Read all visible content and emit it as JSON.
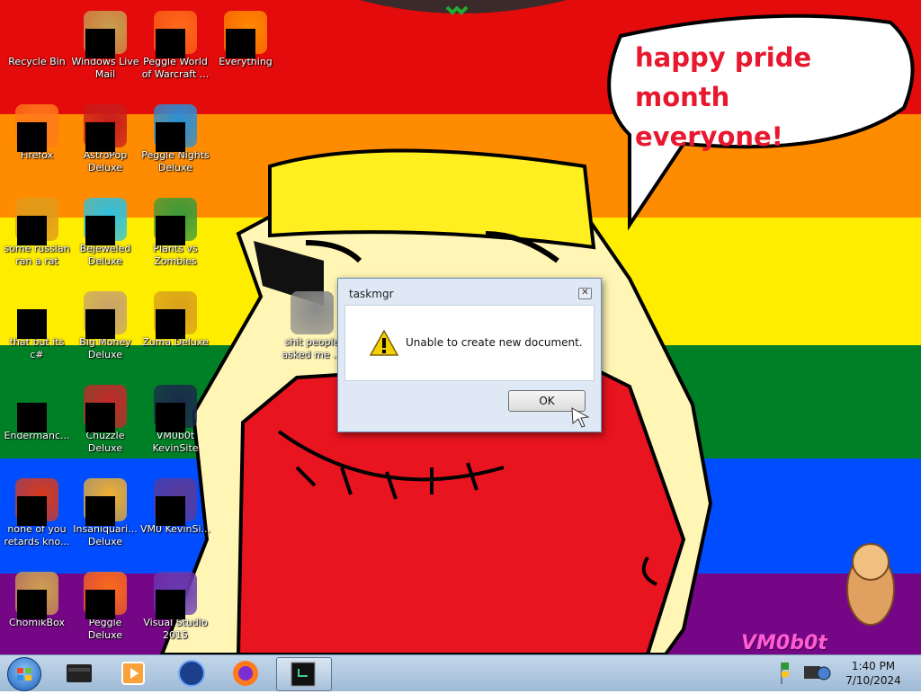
{
  "wallpaper": {
    "stripes": [
      "#e30b0b",
      "#ff8c00",
      "#ffed00",
      "#008026",
      "#004dff",
      "#750787"
    ],
    "speech_bubble": [
      "happy pride month",
      "everyone!"
    ],
    "watermark": "VM0b0t"
  },
  "desktop_icons": [
    {
      "label": "Recycle Bin",
      "icon": "recycle-bin-icon",
      "redacted": false
    },
    {
      "label": "Windows Live Mail",
      "icon": "mail-icon",
      "redacted": true
    },
    {
      "label": "Peggle World of Warcraft ...",
      "icon": "peggle-icon",
      "redacted": true
    },
    {
      "label": "Everything",
      "icon": "search-icon",
      "redacted": true
    },
    {
      "label": "Firefox",
      "icon": "firefox-icon",
      "redacted": true
    },
    {
      "label": "AstroPop Deluxe",
      "icon": "astropop-icon",
      "redacted": true
    },
    {
      "label": "Peggle Nights Deluxe",
      "icon": "peggle-nights-icon",
      "redacted": true
    },
    {
      "label": "some russian ran a rat",
      "icon": "app-icon",
      "redacted": true
    },
    {
      "label": "Bejeweled Deluxe",
      "icon": "gem-icon",
      "redacted": true
    },
    {
      "label": "Plants vs Zombies",
      "icon": "plant-icon",
      "redacted": true
    },
    {
      "label": "that but its c#",
      "icon": "shortcut-icon",
      "redacted": true
    },
    {
      "label": "Big Money Deluxe",
      "icon": "money-bag-icon",
      "redacted": true
    },
    {
      "label": "Zuma Deluxe",
      "icon": "zuma-icon",
      "redacted": true
    },
    {
      "label": "shit people asked me ...",
      "icon": "folder-icon",
      "redacted": false
    },
    {
      "label": "Endermanc...",
      "icon": "terminal-icon",
      "redacted": true
    },
    {
      "label": "Chuzzle Deluxe",
      "icon": "chuzzle-icon",
      "redacted": true
    },
    {
      "label": "VM0b0t KevinSite",
      "icon": "website-icon",
      "redacted": true
    },
    {
      "label": "none of you retards kno...",
      "icon": "app-icon",
      "redacted": true
    },
    {
      "label": "Insaniquari... Deluxe",
      "icon": "fish-icon",
      "redacted": true
    },
    {
      "label": "VM0 KevinSi...",
      "icon": "website-icon",
      "redacted": true
    },
    {
      "label": "ChomikBox",
      "icon": "hamster-icon",
      "redacted": true
    },
    {
      "label": "Peggle Deluxe",
      "icon": "peggle-icon",
      "redacted": true
    },
    {
      "label": "Visual Studio 2015",
      "icon": "visual-studio-icon",
      "redacted": true
    }
  ],
  "dialog": {
    "title": "taskmgr",
    "close_label": "✕",
    "message": "Unable to create new document.",
    "ok_label": "OK",
    "icon": "warning-icon"
  },
  "taskbar": {
    "start_icon": "windows-start-icon",
    "pinned": [
      {
        "name": "explorer",
        "icon": "drive-icon"
      },
      {
        "name": "media-player",
        "icon": "media-player-icon"
      },
      {
        "name": "globe",
        "icon": "globe-icon"
      },
      {
        "name": "firefox",
        "icon": "firefox-icon"
      },
      {
        "name": "taskmgr",
        "icon": "taskmgr-icon"
      }
    ],
    "tray_icons": [
      "flag-icon",
      "network-icon"
    ],
    "time": "1:40 PM",
    "date": "7/10/2024"
  }
}
